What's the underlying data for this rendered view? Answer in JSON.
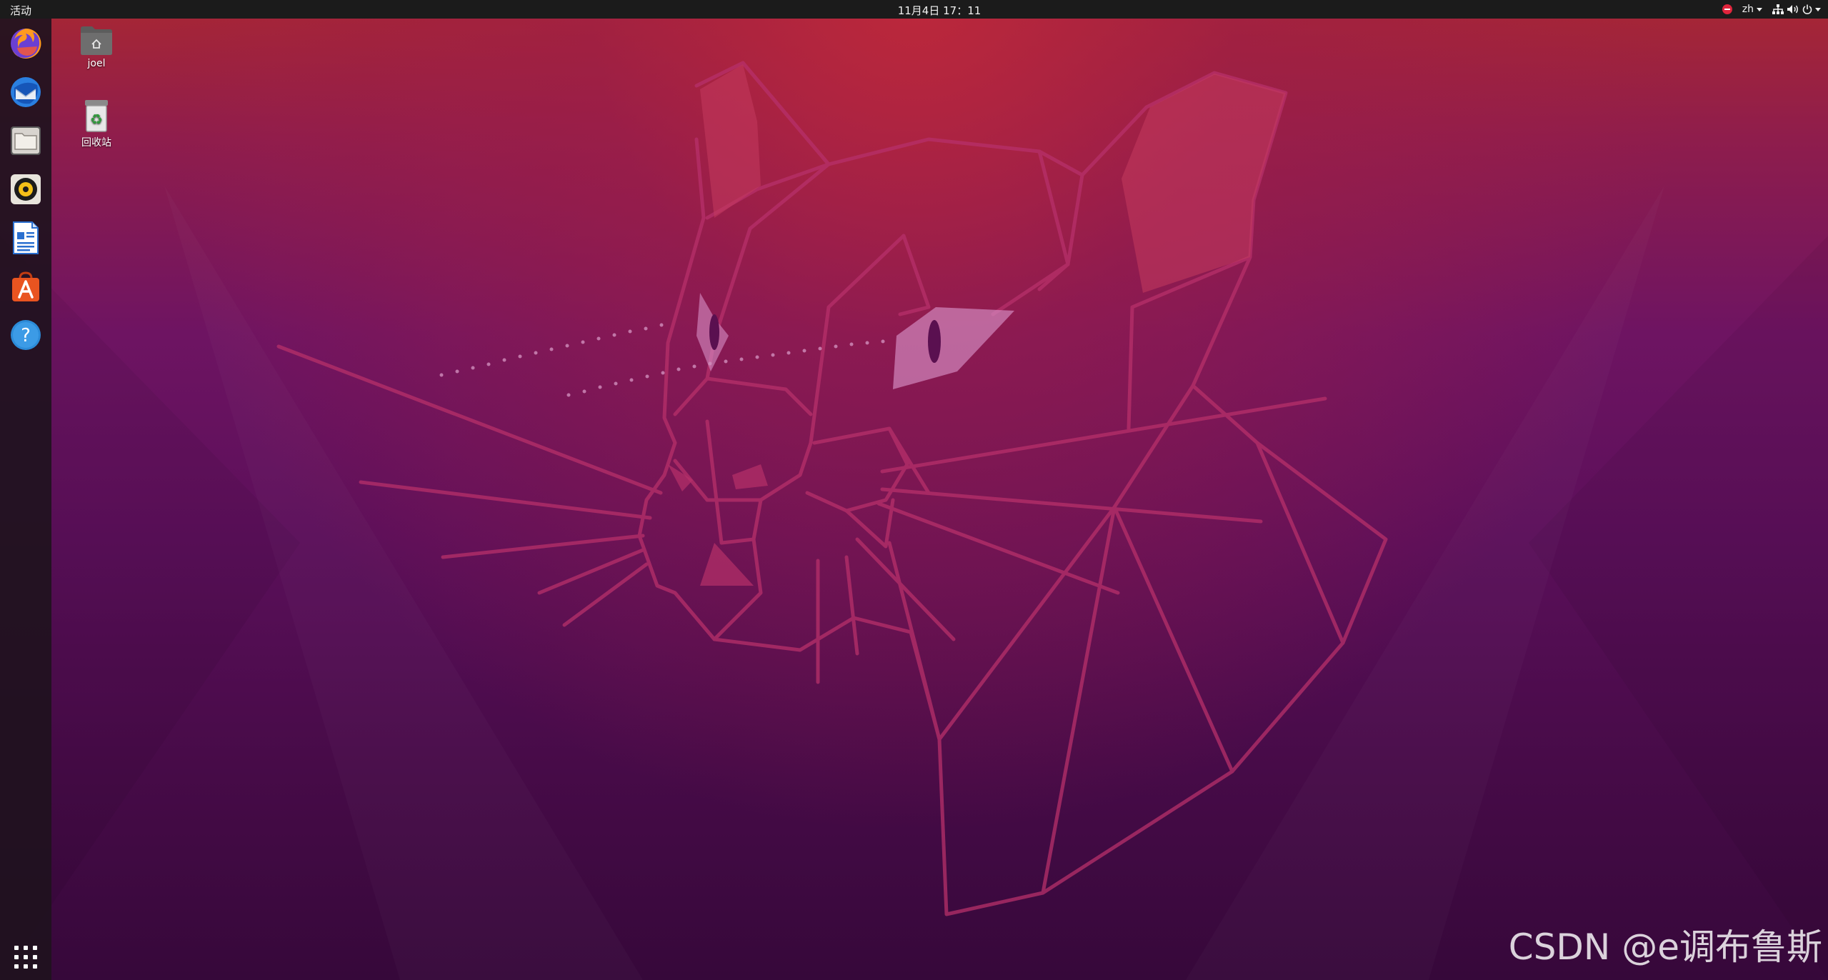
{
  "topbar": {
    "activities_label": "活动",
    "clock": "11月4日  17：11",
    "input_method": "zh"
  },
  "dock": {
    "apps": [
      {
        "name": "firefox",
        "icon": "firefox-icon"
      },
      {
        "name": "thunderbird",
        "icon": "thunderbird-icon"
      },
      {
        "name": "files",
        "icon": "files-icon"
      },
      {
        "name": "rhythmbox",
        "icon": "rhythmbox-icon"
      },
      {
        "name": "libreoffice-writer",
        "icon": "writer-icon"
      },
      {
        "name": "software",
        "icon": "software-center-icon"
      },
      {
        "name": "help",
        "icon": "help-icon"
      }
    ],
    "show_apps_icon": "app-grid-icon"
  },
  "desktop": {
    "home_label": "joel",
    "trash_label": "回收站"
  },
  "watermark": "CSDN @e调布鲁斯",
  "colors": {
    "topbar": "#1b1b1b",
    "dock": "#20121e",
    "wallpaper_top": "#a82733",
    "wallpaper_bottom": "#36083a",
    "ubuntu_orange": "#e95420"
  }
}
